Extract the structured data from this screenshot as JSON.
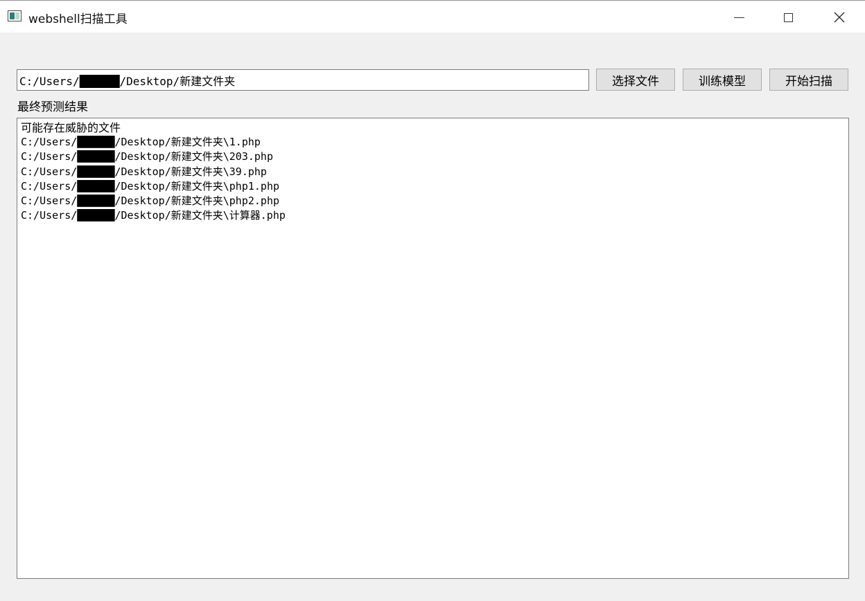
{
  "window": {
    "title": "webshell扫描工具",
    "controls": {
      "minimize_icon": "minimize-icon",
      "maximize_icon": "maximize-icon",
      "close_icon": "close-icon"
    }
  },
  "toolbar": {
    "path_value": "C:/Users/██████/Desktop/新建文件夹",
    "select_file_label": "选择文件",
    "train_model_label": "训练模型",
    "start_scan_label": "开始扫描"
  },
  "results": {
    "label": "最终预测结果",
    "header": "可能存在威胁的文件",
    "files": [
      "C:/Users/██████/Desktop/新建文件夹\\1.php",
      "C:/Users/██████/Desktop/新建文件夹\\203.php",
      "C:/Users/██████/Desktop/新建文件夹\\39.php",
      "C:/Users/██████/Desktop/新建文件夹\\php1.php",
      "C:/Users/██████/Desktop/新建文件夹\\php2.php",
      "C:/Users/██████/Desktop/新建文件夹\\计算器.php"
    ]
  },
  "colors": {
    "window_bg": "#f0f0f0",
    "titlebar_bg": "#ffffff",
    "button_bg": "#e1e1e1",
    "icon_accent": "#2f7d74"
  }
}
